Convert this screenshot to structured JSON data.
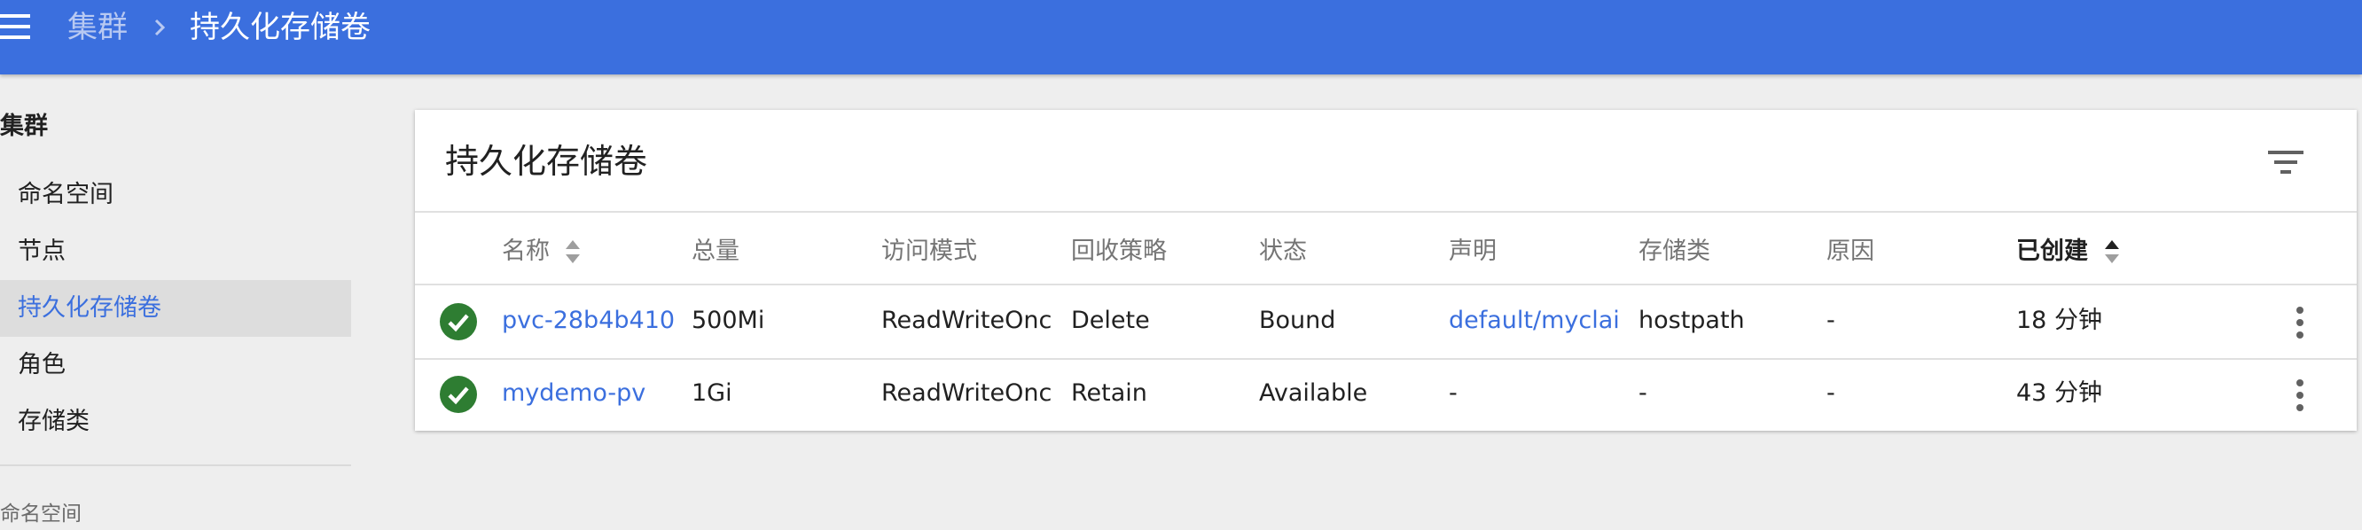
{
  "header": {
    "breadcrumb_root": "集群",
    "breadcrumb_current": "持久化存储卷",
    "bar_color": "#3b6fde"
  },
  "sidebar": {
    "section_title": "集群",
    "items": [
      {
        "label": "命名空间",
        "active": false
      },
      {
        "label": "节点",
        "active": false
      },
      {
        "label": "持久化存储卷",
        "active": true
      },
      {
        "label": "角色",
        "active": false
      },
      {
        "label": "存储类",
        "active": false
      }
    ],
    "namespace_label": "命名空间"
  },
  "card": {
    "title": "持久化存储卷",
    "columns": [
      "名称",
      "总量",
      "访问模式",
      "回收策略",
      "状态",
      "声明",
      "存储类",
      "原因",
      "已创建"
    ],
    "rows": [
      {
        "status": "ok",
        "name": "pvc-28b4b410",
        "capacity": "500Mi",
        "access_mode": "ReadWriteOnc",
        "reclaim_policy": "Delete",
        "status_text": "Bound",
        "claim": "default/myclai",
        "storage_class": "hostpath",
        "reason": "-",
        "created": "18 分钟"
      },
      {
        "status": "ok",
        "name": "mydemo-pv",
        "capacity": "1Gi",
        "access_mode": "ReadWriteOnc",
        "reclaim_policy": "Retain",
        "status_text": "Available",
        "claim": "-",
        "storage_class": "-",
        "reason": "-",
        "created": "43 分钟"
      }
    ]
  },
  "colors": {
    "accent": "#3b6fde",
    "status_ok": "#2e7d32",
    "active_bg": "#dddddd"
  },
  "icons": [
    "menu-icon",
    "chevron-right-icon",
    "filter-icon",
    "sort-icon",
    "check-circle-icon",
    "more-vert-icon"
  ]
}
